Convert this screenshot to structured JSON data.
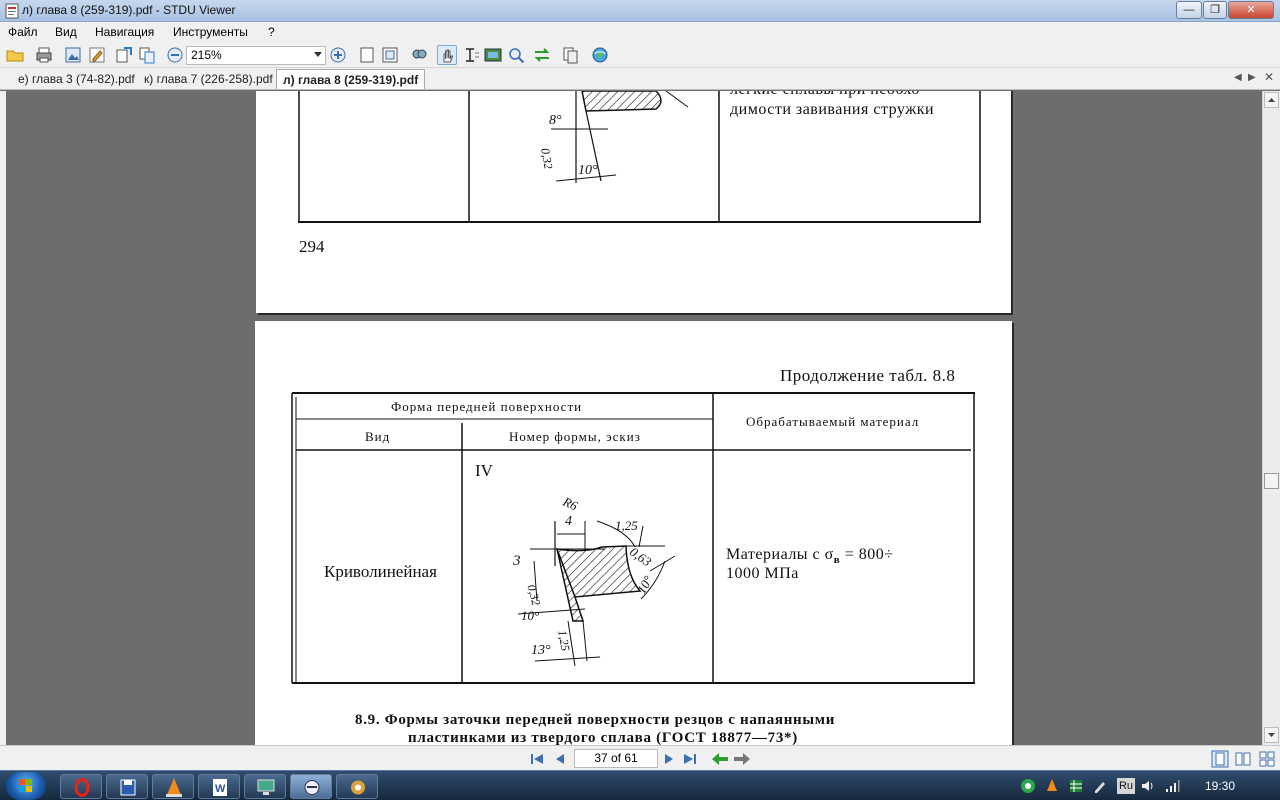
{
  "window": {
    "title": "л) глава 8 (259-319).pdf - STDU Viewer",
    "minimize": "—",
    "maximize": "❐",
    "close": "✕"
  },
  "menu": [
    "Файл",
    "Вид",
    "Навигация",
    "Инструменты",
    "?"
  ],
  "toolbar": {
    "zoom": "215%"
  },
  "tabs": [
    {
      "label": "е) глава 3 (74-82).pdf",
      "active": false
    },
    {
      "label": "к) глава 7 (226-258).pdf",
      "active": false
    },
    {
      "label": "л) глава 8 (259-319).pdf",
      "active": true
    }
  ],
  "tab_nav": {
    "prev": "◀",
    "next": "▶",
    "close": "✕"
  },
  "page1": {
    "text_right_1": "легкие сплавы при необхо-",
    "text_right_2": "димости завивания стружки",
    "sketch_labels": {
      "a": "8°",
      "b": "0,32",
      "c": "10°"
    },
    "page_number": "294"
  },
  "page2": {
    "caption": "Продолжение табл. 8.8",
    "header_top": "Форма передней поверхности",
    "header_col1": "Вид",
    "header_col2": "Номер формы, эскиз",
    "header_col3": "Обрабатываемый материал",
    "row": {
      "form_number": "IV",
      "type": "Криволинейная",
      "material_line1_prefix": "Материалы с σ",
      "material_subscript": "в",
      "material_line1_suffix": " = 800÷",
      "material_line2": "1000 МПа"
    },
    "sketch_labels": {
      "r": "R6",
      "four": "4",
      "r125": "1,25",
      "r063": "0,63",
      "three": "3",
      "r032": "0,32",
      "a10a": "10°",
      "a10b": "10°",
      "a13": "13°",
      "b125": "1,25"
    },
    "section_1": "8.9. Формы заточки передней поверхности резцов с напаянными",
    "section_2": "пластинками из твердого сплава (ГОСТ 18877—73*)"
  },
  "status": {
    "page_indicator": "37 of 61"
  },
  "taskbar": {
    "language": "Ru",
    "clock": "19:30"
  }
}
